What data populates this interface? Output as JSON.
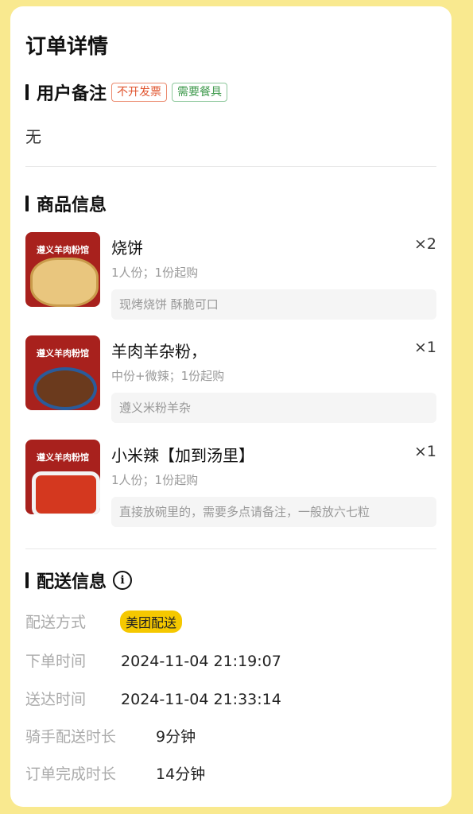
{
  "page_title": "订单详情",
  "user_remark": {
    "title": "用户备注",
    "tags": [
      "不开发票",
      "需要餐具"
    ],
    "content": "无"
  },
  "goods": {
    "title": "商品信息",
    "items": [
      {
        "brand": "遵义羊肉粉馆",
        "name": "烧饼",
        "qty": "×2",
        "spec": "1人份；1份起购",
        "desc": "现烤烧饼 酥脆可口"
      },
      {
        "brand": "遵义羊肉粉馆",
        "name": "羊肉羊杂粉，",
        "qty": "×1",
        "spec": "中份+微辣；1份起购",
        "desc": "遵义米粉羊杂"
      },
      {
        "brand": "遵义羊肉粉馆",
        "name": "小米辣【加到汤里】",
        "qty": "×1",
        "spec": "1人份；1份起购",
        "desc": "直接放碗里的，需要多点请备注，一般放六七粒"
      }
    ]
  },
  "delivery": {
    "title": "配送信息",
    "info_icon": "i",
    "rows": [
      {
        "label": "配送方式",
        "value": "美团配送"
      },
      {
        "label": "下单时间",
        "value": "2024-11-04 21:19:07"
      },
      {
        "label": "送达时间",
        "value": "2024-11-04 21:33:14"
      },
      {
        "label": "骑手配送时长",
        "value": "9分钟"
      },
      {
        "label": "订单完成时长",
        "value": "14分钟"
      }
    ]
  }
}
